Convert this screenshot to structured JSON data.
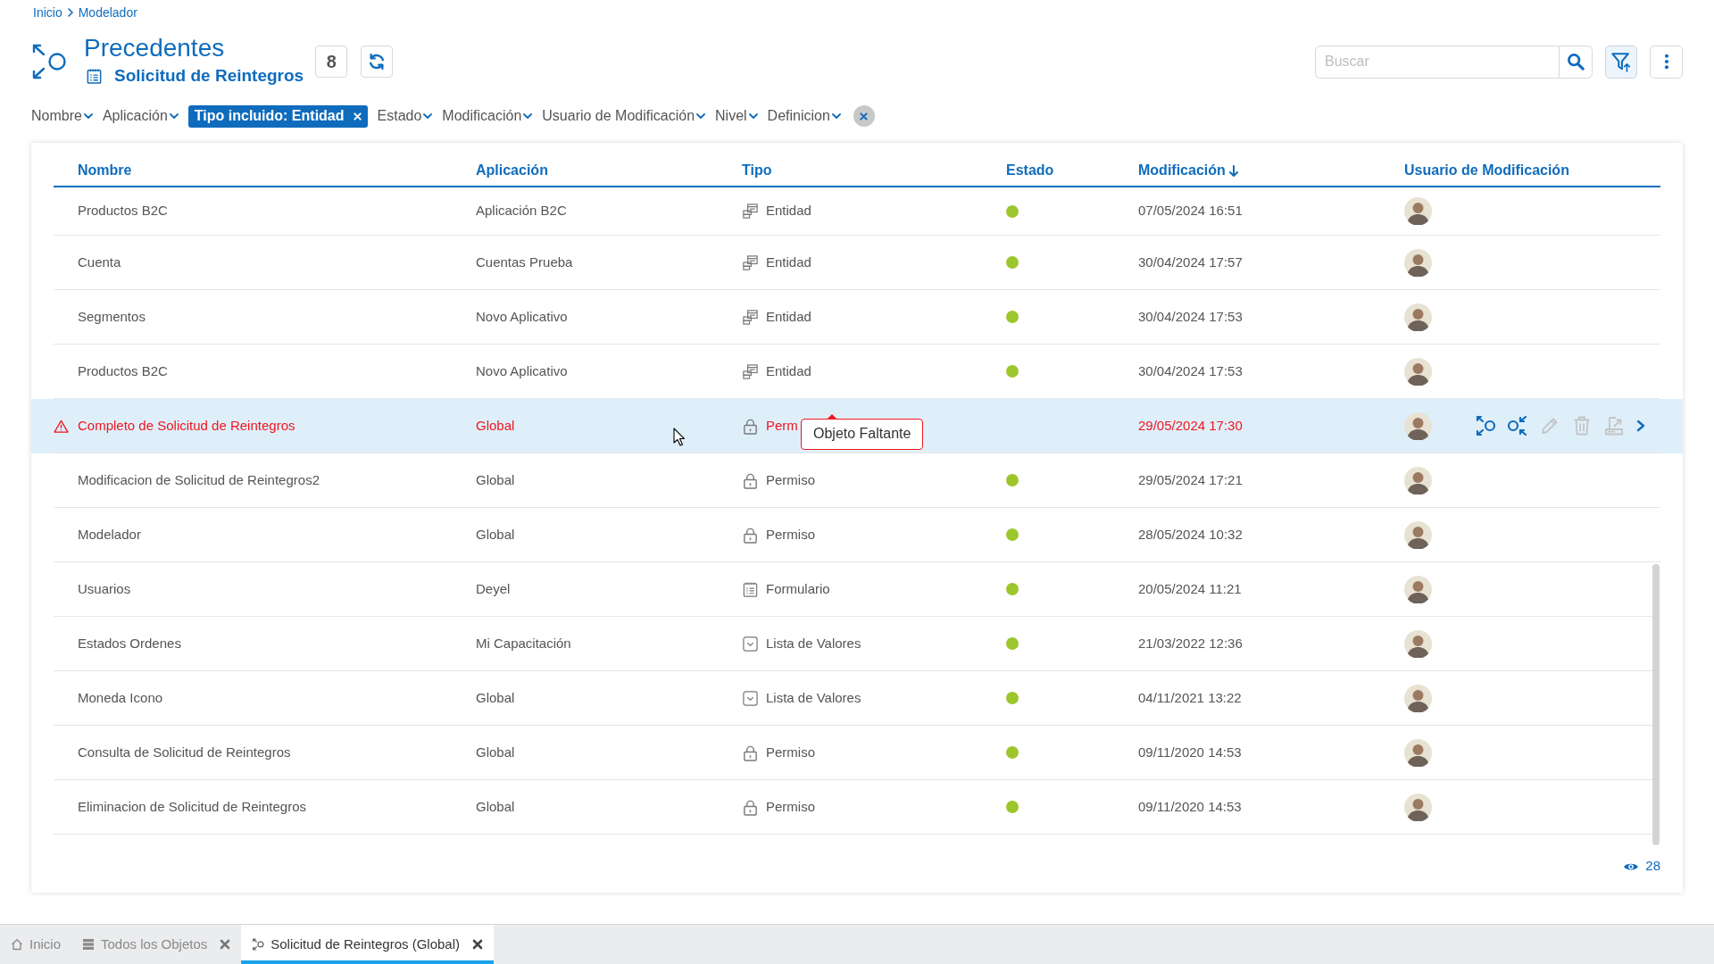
{
  "breadcrumb": [
    {
      "label": "Inicio"
    },
    {
      "label": "Modelador"
    }
  ],
  "header": {
    "title": "Precedentes",
    "subtitle": "Solicitud de Reintegros",
    "count": "8"
  },
  "search": {
    "placeholder": "Buscar"
  },
  "filters": [
    {
      "kind": "dropdown",
      "label": "Nombre"
    },
    {
      "kind": "dropdown",
      "label": "Aplicación"
    },
    {
      "kind": "chip",
      "label": "Tipo incluido: Entidad"
    },
    {
      "kind": "dropdown",
      "label": "Estado"
    },
    {
      "kind": "dropdown",
      "label": "Modificación"
    },
    {
      "kind": "dropdown",
      "label": "Usuario de Modificación"
    },
    {
      "kind": "dropdown",
      "label": "Nivel"
    },
    {
      "kind": "dropdown",
      "label": "Definicion"
    }
  ],
  "table": {
    "columns": [
      {
        "label": "Nombre",
        "sorted": false
      },
      {
        "label": "Aplicación",
        "sorted": false
      },
      {
        "label": "Tipo",
        "sorted": false
      },
      {
        "label": "Estado",
        "sorted": false
      },
      {
        "label": "Modificación",
        "sorted": true
      },
      {
        "label": "Usuario de Modificación",
        "sorted": false
      }
    ],
    "rows": [
      {
        "name": "Productos B2C",
        "application": "Aplicación B2C",
        "type": {
          "kind": "entity",
          "label": "Entidad"
        },
        "modified": "07/05/2024 16:51",
        "error": false,
        "selected": false
      },
      {
        "name": "Cuenta",
        "application": "Cuentas Prueba",
        "type": {
          "kind": "entity",
          "label": "Entidad"
        },
        "modified": "30/04/2024 17:57",
        "error": false,
        "selected": false
      },
      {
        "name": "Segmentos",
        "application": "Novo Aplicativo",
        "type": {
          "kind": "entity",
          "label": "Entidad"
        },
        "modified": "30/04/2024 17:53",
        "error": false,
        "selected": false
      },
      {
        "name": "Productos B2C",
        "application": "Novo Aplicativo",
        "type": {
          "kind": "entity",
          "label": "Entidad"
        },
        "modified": "30/04/2024 17:53",
        "error": false,
        "selected": false
      },
      {
        "name": "Completo de Solicitud de Reintegros",
        "application": "Global",
        "type": {
          "kind": "permission",
          "label": "Perm"
        },
        "modified": "29/05/2024 17:30",
        "error": true,
        "selected": true,
        "tooltip": "Objeto Faltante"
      },
      {
        "name": "Modificacion de Solicitud de Reintegros2",
        "application": "Global",
        "type": {
          "kind": "permission",
          "label": "Permiso"
        },
        "modified": "29/05/2024 17:21",
        "error": false,
        "selected": false
      },
      {
        "name": "Modelador",
        "application": "Global",
        "type": {
          "kind": "permission",
          "label": "Permiso"
        },
        "modified": "28/05/2024 10:32",
        "error": false,
        "selected": false
      },
      {
        "name": "Usuarios",
        "application": "Deyel",
        "type": {
          "kind": "form",
          "label": "Formulario"
        },
        "modified": "20/05/2024 11:21",
        "error": false,
        "selected": false
      },
      {
        "name": "Estados Ordenes",
        "application": "Mi Capacitación",
        "type": {
          "kind": "list",
          "label": "Lista de Valores"
        },
        "modified": "21/03/2022 12:36",
        "error": false,
        "selected": false
      },
      {
        "name": "Moneda Icono",
        "application": "Global",
        "type": {
          "kind": "list",
          "label": "Lista de Valores"
        },
        "modified": "04/11/2021 13:22",
        "error": false,
        "selected": false
      },
      {
        "name": "Consulta de Solicitud de Reintegros",
        "application": "Global",
        "type": {
          "kind": "permission",
          "label": "Permiso"
        },
        "modified": "09/11/2020 14:53",
        "error": false,
        "selected": false
      },
      {
        "name": "Eliminacion de Solicitud de Reintegros",
        "application": "Global",
        "type": {
          "kind": "permission",
          "label": "Permiso"
        },
        "modified": "09/11/2020 14:53",
        "error": false,
        "selected": false
      }
    ],
    "row_actions": [
      {
        "kind": "precedents",
        "disabled": false
      },
      {
        "kind": "dependents",
        "disabled": false
      },
      {
        "kind": "edit",
        "disabled": true
      },
      {
        "kind": "delete",
        "disabled": true
      },
      {
        "kind": "export",
        "disabled": true
      },
      {
        "kind": "more",
        "disabled": false
      }
    ]
  },
  "footer": {
    "count": "28"
  },
  "tabs": [
    {
      "kind": "home",
      "label": "Inicio",
      "selected": false,
      "closable": false
    },
    {
      "kind": "list",
      "label": "Todos los Objetos",
      "selected": false,
      "closable": true
    },
    {
      "kind": "precedents",
      "label": "Solicitud de Reintegros (Global)",
      "selected": true,
      "closable": true
    }
  ]
}
